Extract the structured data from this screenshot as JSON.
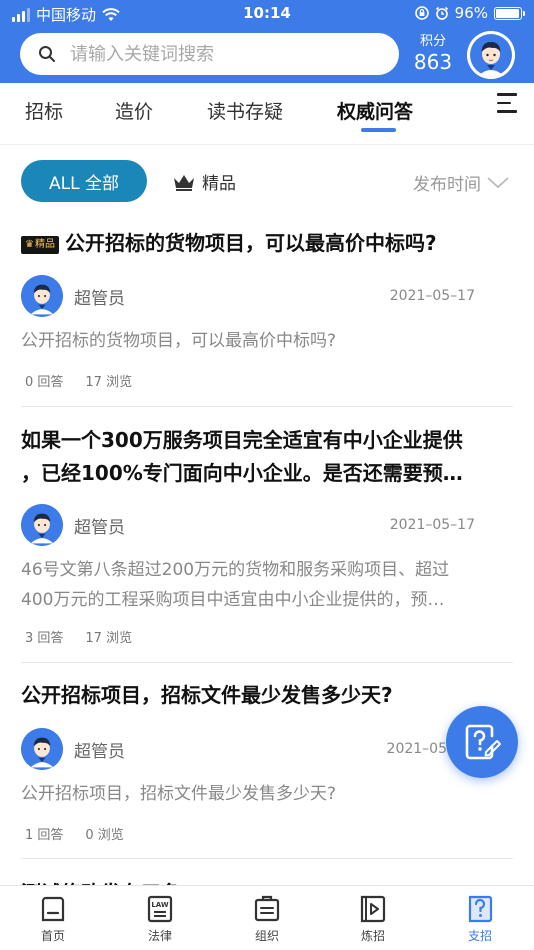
{
  "status_bar": {
    "carrier": "中国移动",
    "time": "10:14",
    "battery": "96%"
  },
  "header": {
    "search_placeholder": "请输入关键词搜索",
    "points_label": "积分",
    "points_value": "863"
  },
  "tabs": [
    {
      "label": "招标"
    },
    {
      "label": "造价"
    },
    {
      "label": "读书存疑"
    },
    {
      "label": "权威问答",
      "active": true
    }
  ],
  "filter": {
    "all_label": "ALL 全部",
    "premium_label": "精品",
    "sort_label": "发布时间"
  },
  "questions": [
    {
      "badge": "精品",
      "title": "公开招标的货物项目，可以最高价中标吗?",
      "author": "超管员",
      "date": "2021–05–17",
      "excerpt": "公开招标的货物项目，可以最高价中标吗?",
      "answers": "0 回答",
      "views": "17 浏览"
    },
    {
      "title_line1": "如果一个300万服务项目完全适宜有中小企业提供",
      "title_line2": "，已经100%专门面向中小企业。是否还需要预…",
      "author": "超管员",
      "date": "2021–05–17",
      "excerpt_line1": "46号文第八条超过200万元的货物和服务采购项目、超过",
      "excerpt_line2": "400万元的工程采购项目中适宜由中小企业提供的，预…",
      "answers": "3 回答",
      "views": "17 浏览"
    },
    {
      "title": "公开招标项目，招标文件最少发售多少天?",
      "author": "超管员",
      "date": "2021–05",
      "excerpt": "公开招标项目，招标文件最少发售多少天?",
      "answers": "1 回答",
      "views": "0 浏览"
    }
  ],
  "peek_title": "测试修改发布三条",
  "bottom_nav": [
    {
      "label": "首页"
    },
    {
      "label": "法律",
      "icon_text": "LAW"
    },
    {
      "label": "组织"
    },
    {
      "label": "炼招"
    },
    {
      "label": "支招",
      "active": true
    }
  ],
  "colors": {
    "brand_blue": "#3d7ce8",
    "pill_teal": "#1b87b8",
    "badge_gold": "#f6c55b"
  }
}
